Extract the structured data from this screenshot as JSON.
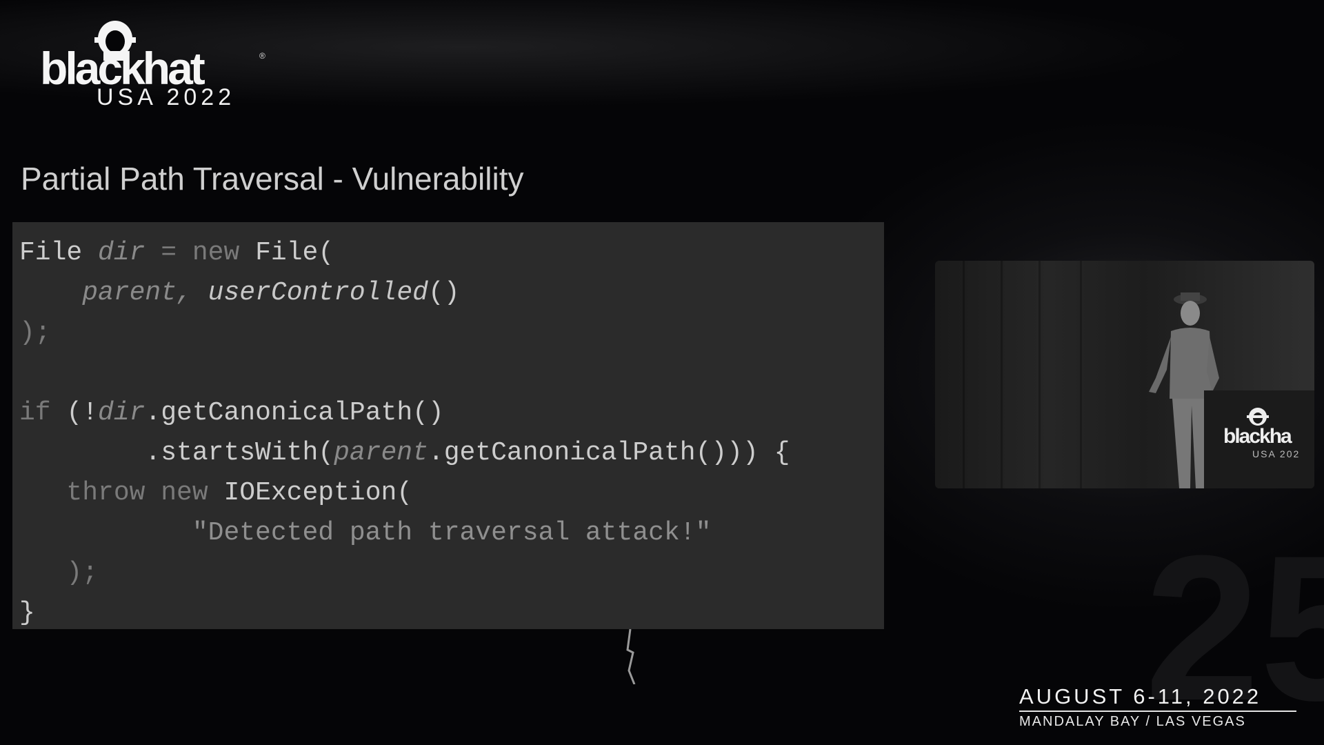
{
  "logo": {
    "word": "blackhat",
    "registered": "®",
    "sub": "USA 2022"
  },
  "slide": {
    "title": "Partial Path Traversal - Vulnerability",
    "code": {
      "l1_a": "File ",
      "l1_b": "dir",
      "l1_c": " = ",
      "l1_d": "new",
      "l1_e": " File(",
      "l2_a": "    ",
      "l2_b": "parent,",
      "l2_c": " ",
      "l2_d": "userControlled",
      "l2_e": "()",
      "l3": ");",
      "l5_a": "if",
      "l5_b": " (!",
      "l5_c": "dir",
      "l5_d": ".getCanonicalPath()",
      "l6_a": "        .startsWith(",
      "l6_b": "parent",
      "l6_c": ".getCanonicalPath())) {",
      "l7_a": "   ",
      "l7_b": "throw new",
      "l7_c": " IOException(",
      "l8_a": "           ",
      "l8_b": "\"Detected path traversal attack!\"",
      "l9": "   );",
      "l10": "}"
    }
  },
  "video": {
    "podium_word": "blackha",
    "podium_sub": "USA 202"
  },
  "footer": {
    "date": "AUGUST 6-11, 2022",
    "venue": "MANDALAY BAY / LAS VEGAS"
  },
  "colors": {
    "background": "#050507",
    "code_bg": "#2b2b2b",
    "title": "#cfcfcf"
  }
}
